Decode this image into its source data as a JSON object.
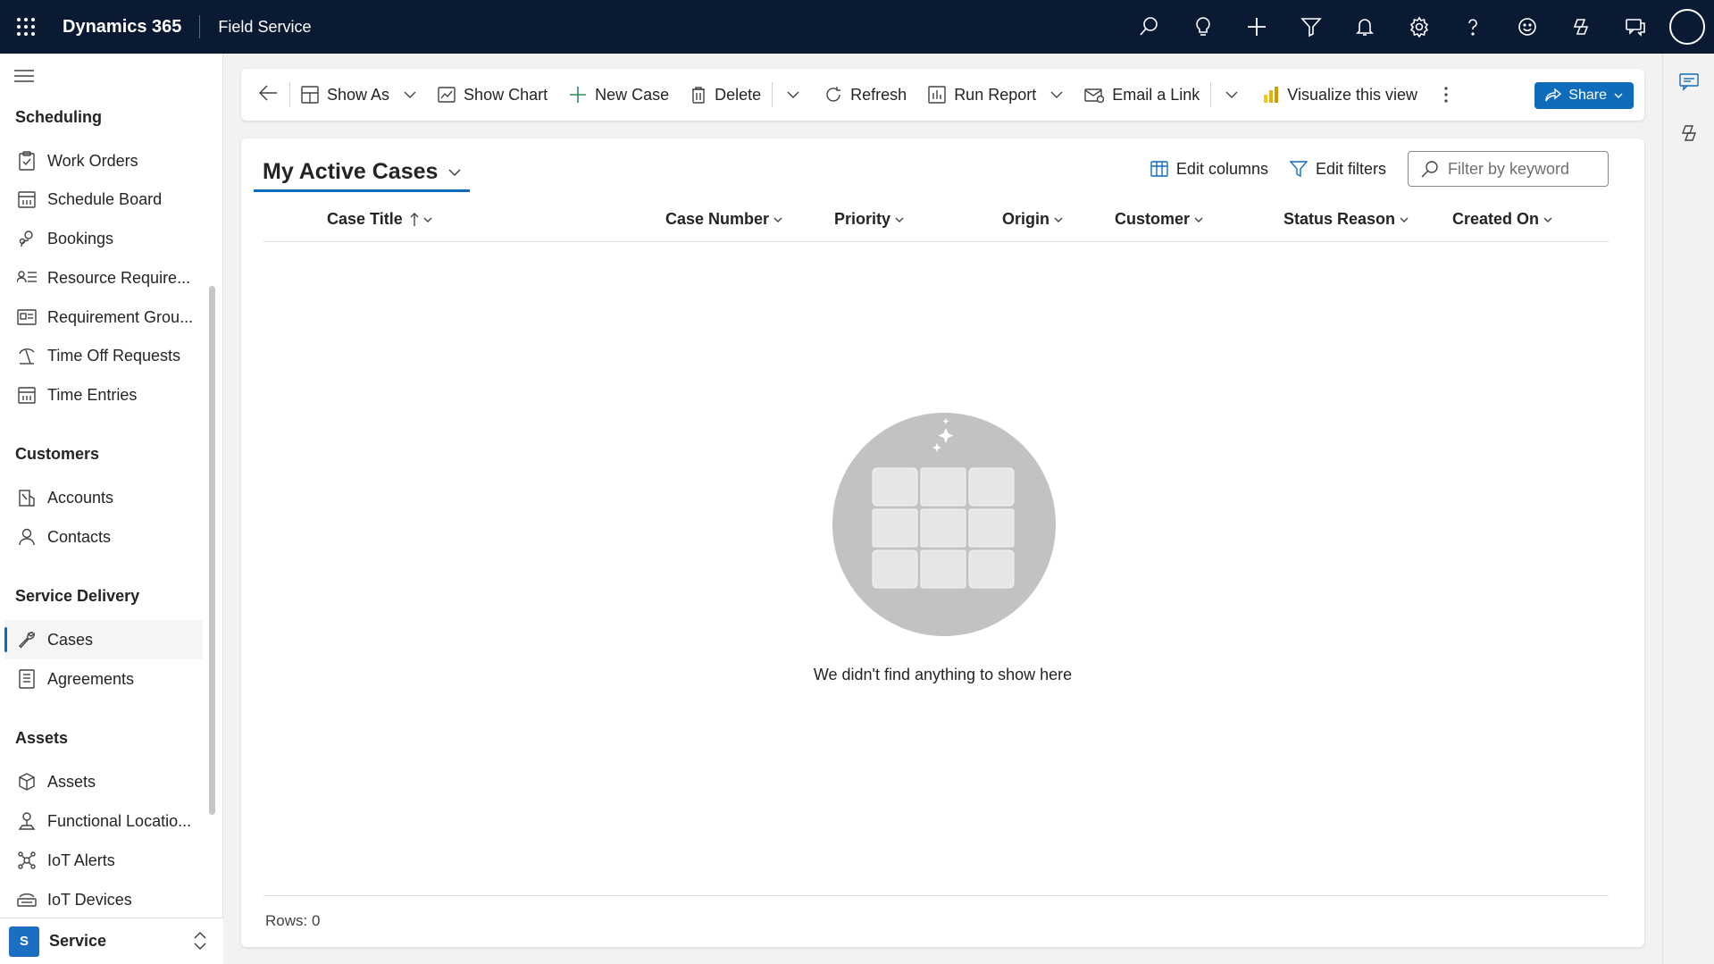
{
  "topbar": {
    "app_name": "Dynamics 365",
    "module_name": "Field Service",
    "icons": [
      "waffle-icon",
      "search-icon",
      "lightbulb-icon",
      "plus-icon",
      "filter-icon",
      "bell-icon",
      "gear-icon",
      "help-icon",
      "smiley-icon",
      "copilot-icon",
      "chat-icon",
      "user-avatar"
    ]
  },
  "sidebar": {
    "groups": [
      {
        "title": "Scheduling",
        "items": [
          {
            "label": "Work Orders",
            "icon": "clipboard-icon"
          },
          {
            "label": "Schedule Board",
            "icon": "calendar-icon"
          },
          {
            "label": "Bookings",
            "icon": "people-icon"
          },
          {
            "label": "Resource Require...",
            "icon": "list-person-icon"
          },
          {
            "label": "Requirement Grou...",
            "icon": "card-icon"
          },
          {
            "label": "Time Off Requests",
            "icon": "beach-icon"
          },
          {
            "label": "Time Entries",
            "icon": "calendar-icon"
          }
        ]
      },
      {
        "title": "Customers",
        "items": [
          {
            "label": "Accounts",
            "icon": "building-icon"
          },
          {
            "label": "Contacts",
            "icon": "person-icon"
          }
        ]
      },
      {
        "title": "Service Delivery",
        "items": [
          {
            "label": "Cases",
            "icon": "wrench-icon",
            "active": true
          },
          {
            "label": "Agreements",
            "icon": "document-icon"
          }
        ]
      },
      {
        "title": "Assets",
        "items": [
          {
            "label": "Assets",
            "icon": "box-icon"
          },
          {
            "label": "Functional Locatio...",
            "icon": "location-icon"
          },
          {
            "label": "IoT Alerts",
            "icon": "iot-icon"
          },
          {
            "label": "IoT Devices",
            "icon": "device-icon"
          }
        ]
      }
    ],
    "area": {
      "badge": "S",
      "name": "Service"
    }
  },
  "commandbar": {
    "show_as": "Show As",
    "show_chart": "Show Chart",
    "new_case": "New Case",
    "delete": "Delete",
    "refresh": "Refresh",
    "run_report": "Run Report",
    "email_link": "Email a Link",
    "visualize": "Visualize this view",
    "share": "Share"
  },
  "view": {
    "title": "My Active Cases",
    "edit_columns": "Edit columns",
    "edit_filters": "Edit filters",
    "filter_placeholder": "Filter by keyword",
    "columns": [
      "Case Title",
      "Case Number",
      "Priority",
      "Origin",
      "Customer",
      "Status Reason",
      "Created On"
    ],
    "sorted_column": "Case Title",
    "empty_message": "We didn't find anything to show here",
    "rows_label": "Rows: 0"
  },
  "colors": {
    "topbar": "#0b1a33",
    "accent": "#0f6cbd",
    "page_bg": "#f3f2f1"
  }
}
